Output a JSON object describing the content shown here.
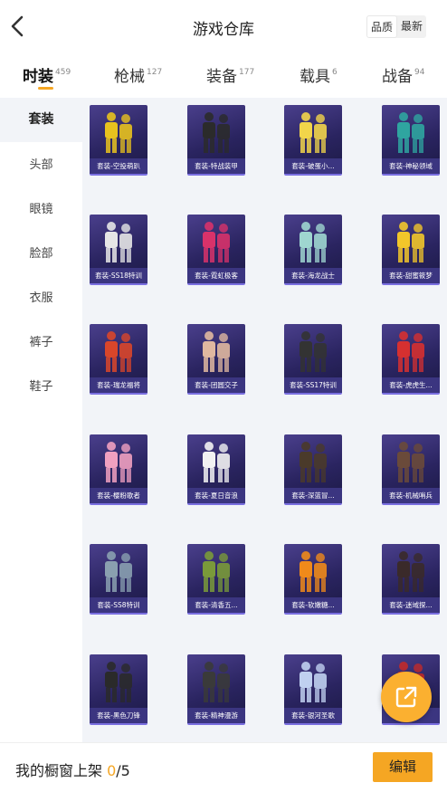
{
  "header": {
    "title": "游戏仓库",
    "sort_options": [
      "品质",
      "最新"
    ]
  },
  "tabs": [
    {
      "label": "时装",
      "count": "459"
    },
    {
      "label": "枪械",
      "count": "127"
    },
    {
      "label": "装备",
      "count": "177"
    },
    {
      "label": "载具",
      "count": "6"
    },
    {
      "label": "战备",
      "count": "94"
    }
  ],
  "sidebar": [
    "套装",
    "头部",
    "眼镜",
    "脸部",
    "衣服",
    "裤子",
    "鞋子"
  ],
  "items": [
    {
      "label": "套装-空投萌趴",
      "color": "#e8c21e"
    },
    {
      "label": "套装-特战装甲",
      "color": "#2b2b2b"
    },
    {
      "label": "套装-破蛋小...",
      "color": "#f2d54a"
    },
    {
      "label": "套装-神秘领域",
      "color": "#2fa5a0"
    },
    {
      "label": "套装-SS18特训",
      "color": "#e6e6e6"
    },
    {
      "label": "套装-霓虹极客",
      "color": "#d8326a"
    },
    {
      "label": "套装-海龙战士",
      "color": "#9fd6d0"
    },
    {
      "label": "套装-甜蜜筱梦",
      "color": "#f2c62a"
    },
    {
      "label": "套装-瑞龙福将",
      "color": "#d9462a"
    },
    {
      "label": "套装-团圆交子",
      "color": "#e0b8a0"
    },
    {
      "label": "套装-SS17特训",
      "color": "#333333"
    },
    {
      "label": "套装-虎虎生...",
      "color": "#d63030"
    },
    {
      "label": "套装-樱粉歌者",
      "color": "#f0a0c0"
    },
    {
      "label": "套装-夏日音浪",
      "color": "#f2f2f2"
    },
    {
      "label": "套装-深蓝冒...",
      "color": "#4a3a2a"
    },
    {
      "label": "套装-机械哨兵",
      "color": "#6a4a3a"
    },
    {
      "label": "套装-SS8特训",
      "color": "#8aa0b0"
    },
    {
      "label": "套装-清香五...",
      "color": "#7a9a3a"
    },
    {
      "label": "套装-软嫩糖...",
      "color": "#f08a1a"
    },
    {
      "label": "套装-迷域探...",
      "color": "#3a2a2a"
    },
    {
      "label": "套装-黑色刀锋",
      "color": "#2a2a2a"
    },
    {
      "label": "套装-精神漫游",
      "color": "#3a3a3a"
    },
    {
      "label": "套装-银河圣歌",
      "color": "#c0d0f0"
    },
    {
      "label": "套装-",
      "color": "#c02a2a"
    }
  ],
  "footer": {
    "label": "我的橱窗上架 ",
    "current": "0",
    "max": "/5",
    "edit_label": "编辑"
  },
  "colors": {
    "accent": "#f5a623",
    "fab": "#fbb030",
    "card": "#2a2460"
  }
}
